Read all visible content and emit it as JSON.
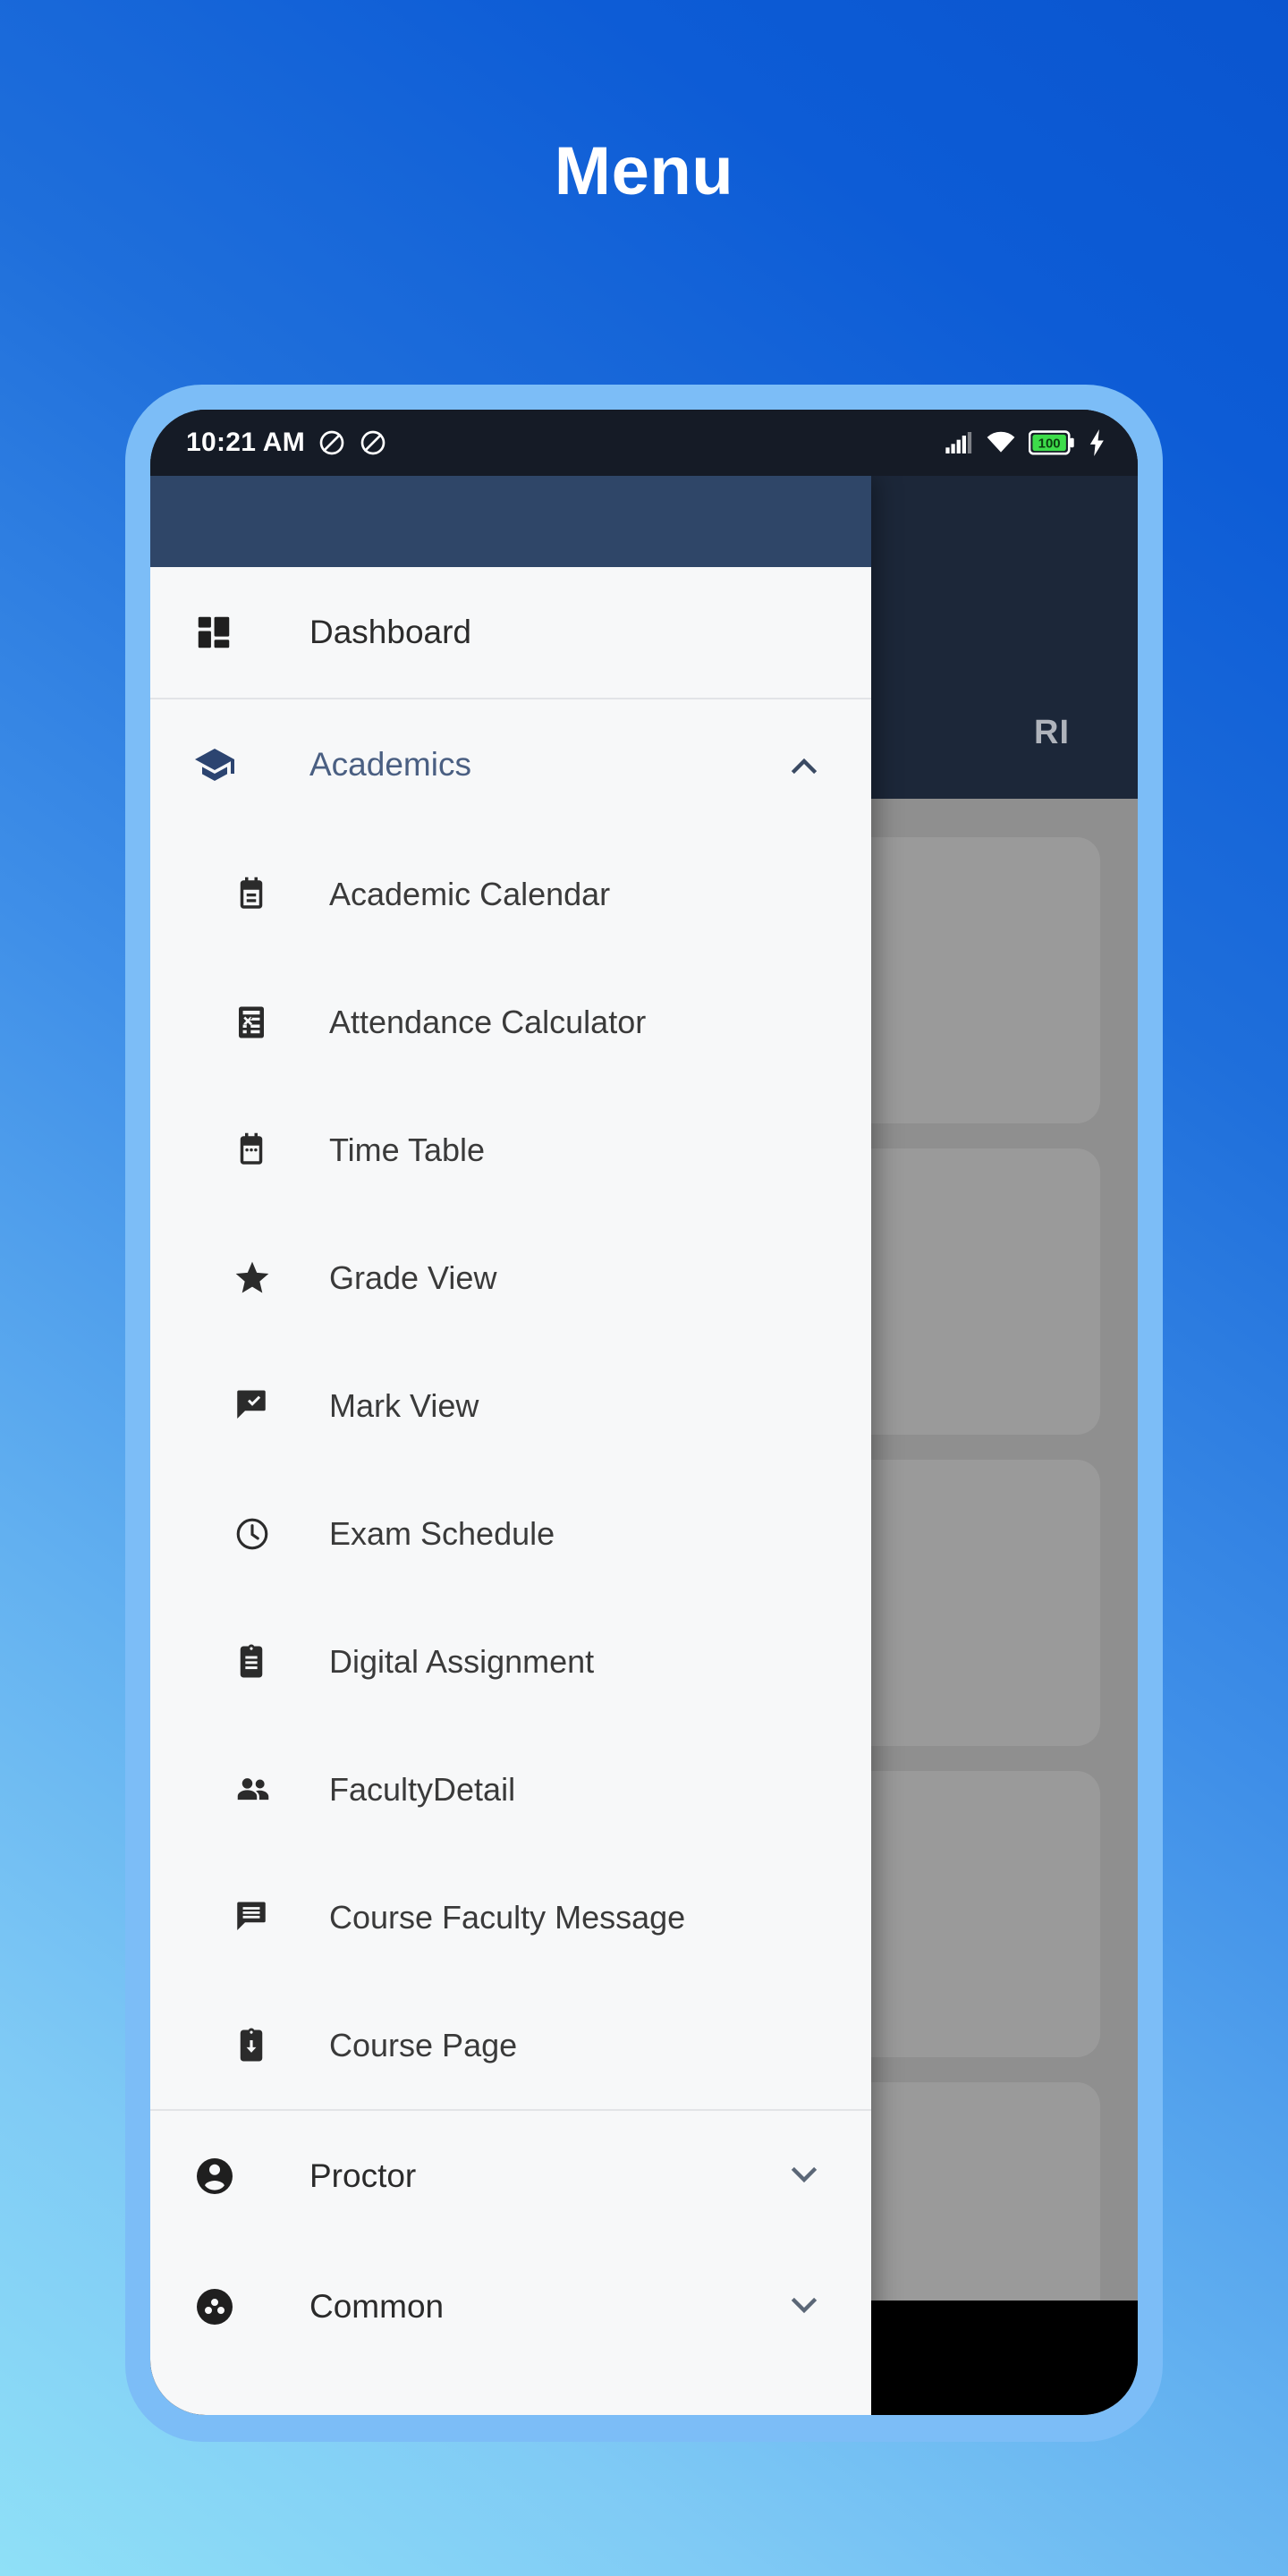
{
  "page": {
    "title": "Menu"
  },
  "status_bar": {
    "time": "10:21 AM",
    "left_icons": [
      "do-not-disturb-icon",
      "mute-icon"
    ],
    "right_icons": [
      "signal-icon",
      "wifi-icon",
      "battery-icon",
      "charging-bolt-icon"
    ],
    "battery_level": "100"
  },
  "background_app": {
    "appbar_title_fragment": "RI",
    "card_ring_label": "%",
    "nav_icon": "refresh-icon"
  },
  "drawer": {
    "items": [
      {
        "label": "Dashboard",
        "icon": "dashboard-icon",
        "expandable": false,
        "expanded": false,
        "chevron": ""
      },
      {
        "label": "Academics",
        "icon": "school-cap-icon",
        "expandable": true,
        "expanded": true,
        "chevron": "chevron-up-icon",
        "accent_color": "#4a5f82",
        "children": [
          {
            "label": "Academic Calendar",
            "icon": "event-note-icon"
          },
          {
            "label": "Attendance Calculator",
            "icon": "calculator-icon"
          },
          {
            "label": "Time Table",
            "icon": "calendar-icon"
          },
          {
            "label": "Grade View",
            "icon": "star-icon"
          },
          {
            "label": "Mark View",
            "icon": "message-check-icon"
          },
          {
            "label": "Exam Schedule",
            "icon": "clock-icon"
          },
          {
            "label": "Digital Assignment",
            "icon": "clipboard-icon"
          },
          {
            "label": "FacultyDetail",
            "icon": "people-icon"
          },
          {
            "label": "Course Faculty Message",
            "icon": "message-lines-icon"
          },
          {
            "label": "Course Page",
            "icon": "clipboard-download-icon"
          }
        ]
      },
      {
        "label": "Proctor",
        "icon": "account-circle-icon",
        "expandable": true,
        "expanded": false,
        "chevron": "chevron-down-icon"
      },
      {
        "label": "Common",
        "icon": "group-work-icon",
        "expandable": true,
        "expanded": false,
        "chevron": "chevron-down-icon"
      }
    ]
  },
  "colors": {
    "gradient_start": "#0a55cf",
    "gradient_end": "#8fe0f7",
    "phone_bezel": "#7cbdf7",
    "drawer_bg": "#f7f8f9",
    "drawer_header": "#2f4668",
    "appbar_dark": "#1c2739",
    "accent_navy": "#2c4470",
    "ring_green": "#1f9a27",
    "battery_green": "#3ddc4a"
  }
}
